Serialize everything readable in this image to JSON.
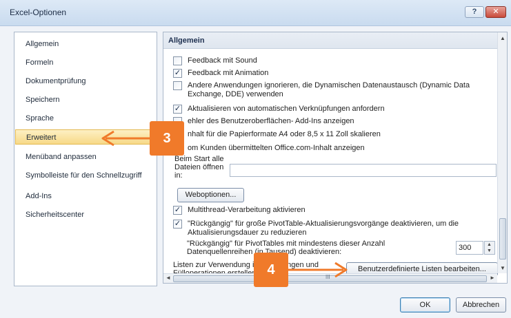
{
  "window": {
    "title": "Excel-Optionen",
    "help_label": "?",
    "close_label": "✕"
  },
  "nav": {
    "items": [
      {
        "label": "Allgemein"
      },
      {
        "label": "Formeln"
      },
      {
        "label": "Dokumentprüfung"
      },
      {
        "label": "Speichern"
      },
      {
        "label": "Sprache"
      },
      {
        "label": "Erweitert",
        "selected": true
      },
      {
        "label": "Menüband anpassen"
      },
      {
        "label": "Symbolleiste für den Schnellzugriff"
      },
      {
        "label": "Add-Ins"
      },
      {
        "label": "Sicherheitscenter"
      }
    ]
  },
  "content": {
    "section_title": "Allgemein",
    "options": [
      {
        "label": "Feedback mit Sound",
        "checked": false
      },
      {
        "label": "Feedback mit Animation",
        "checked": true
      },
      {
        "label": "Andere Anwendungen ignorieren, die Dynamischen Datenaustausch (Dynamic Data Exchange, DDE) verwenden",
        "checked": false
      },
      {
        "label": "Aktualisieren von automatischen Verknüpfungen anfordern",
        "checked": true
      },
      {
        "label": "ehler des Benutzeroberflächen- Add-Ins anzeigen",
        "checked": false
      },
      {
        "label": "nhalt für die Papierformate A4 oder 8,5 x 11 Zoll skalieren",
        "checked": false
      },
      {
        "label": "om Kunden übermittelten Office.com-Inhalt anzeigen",
        "checked": false
      }
    ],
    "start_label": "Beim Start alle Dateien öffnen in:",
    "start_value": "",
    "web_button": "Weboptionen...",
    "multithread": {
      "label": "Multithread-Verarbeitung aktivieren",
      "checked": true
    },
    "undo_pivot": {
      "label": "\"Rückgängig\" für große PivotTable-Aktualisierungsvorgänge deaktivieren, um die Aktualisierungsdauer zu reduzieren",
      "checked": true
    },
    "undo_count_label": "\"Rückgängig\" für PivotTables mit mindestens dieser Anzahl Datenquellenreihen (in Tausend) deaktivieren:",
    "undo_count_value": "300",
    "lists_label": "Listen zur Verwendung in Sortierungen und Fülloperationen erstellen:",
    "custom_lists_button": "Benutzerdefinierte Listen bearbeiten..."
  },
  "footer": {
    "ok_label": "OK",
    "cancel_label": "Abbrechen"
  },
  "annotations": {
    "badge_3": "3",
    "badge_4": "4",
    "accent_color": "#f07a2a"
  },
  "scroll": {
    "up": "▲",
    "down": "▼",
    "left": "◄",
    "right": "►",
    "grip": "III"
  }
}
